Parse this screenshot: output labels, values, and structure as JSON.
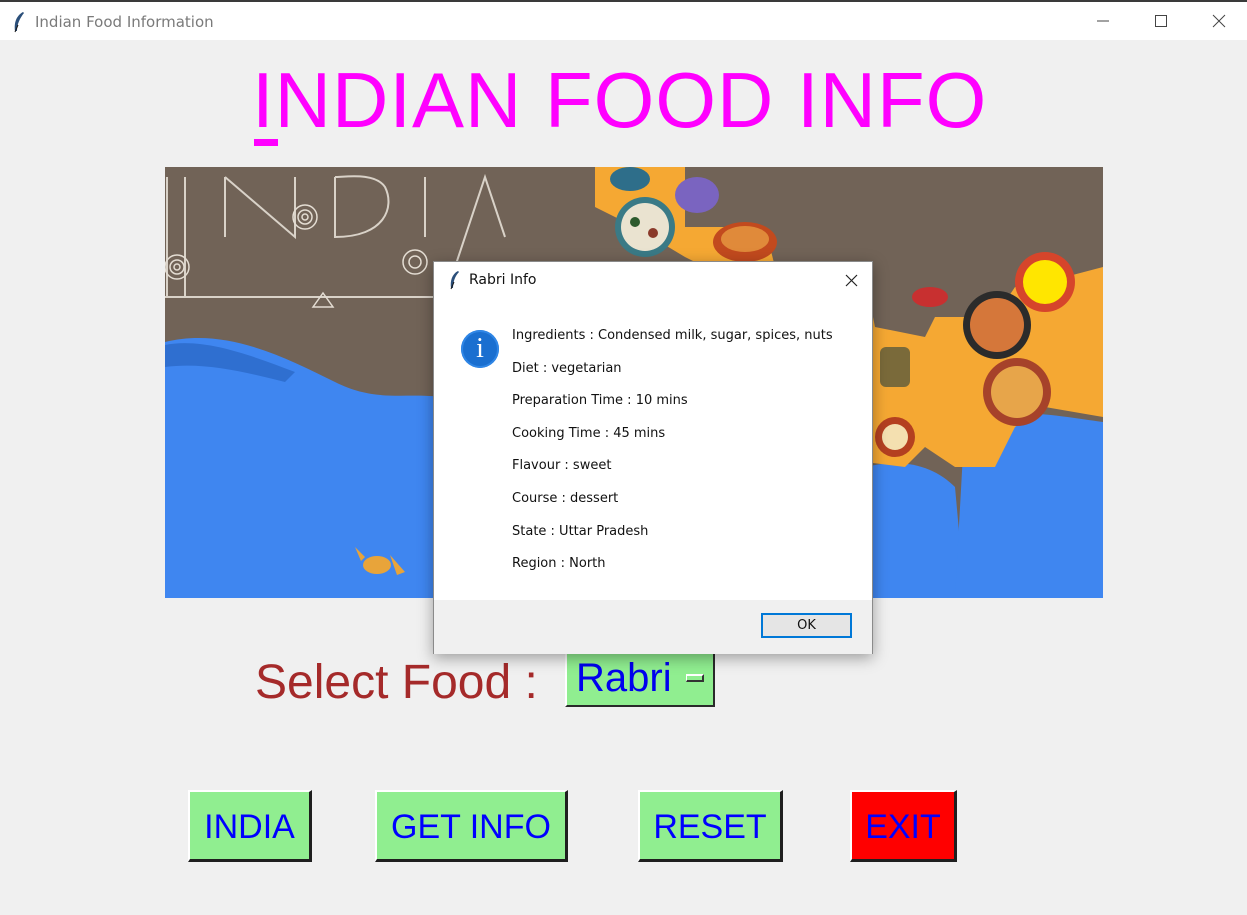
{
  "window": {
    "title": "Indian Food Information",
    "controls": [
      "minimize-icon",
      "maximize-icon",
      "close-icon"
    ]
  },
  "app": {
    "heading": "INDIAN FOOD INFO",
    "select_label": "Select Food :",
    "selected_food": "Rabri"
  },
  "buttons": {
    "india": "INDIA",
    "get_info": "GET INFO",
    "reset": "RESET",
    "exit": "EXIT"
  },
  "dialog": {
    "title": "Rabri Info",
    "icon": "info-icon",
    "ok_label": "OK",
    "lines": [
      "Ingredients  :  Condensed milk, sugar, spices, nuts",
      "Diet  :  vegetarian",
      "Preparation Time  :  10 mins",
      "Cooking Time  :  45 mins",
      "Flavour  :  sweet",
      "Course  :  dessert",
      "State  :  Uttar Pradesh",
      "Region  :  North"
    ]
  },
  "colors": {
    "heading": "#ff00ff",
    "select_label": "#a52a2a",
    "button_bg": "#90ee90",
    "button_text": "#0000ff",
    "exit_bg": "#ff0000",
    "banner_bg": "#716357",
    "sea": "#3f86f0",
    "land": "#f5a833"
  }
}
